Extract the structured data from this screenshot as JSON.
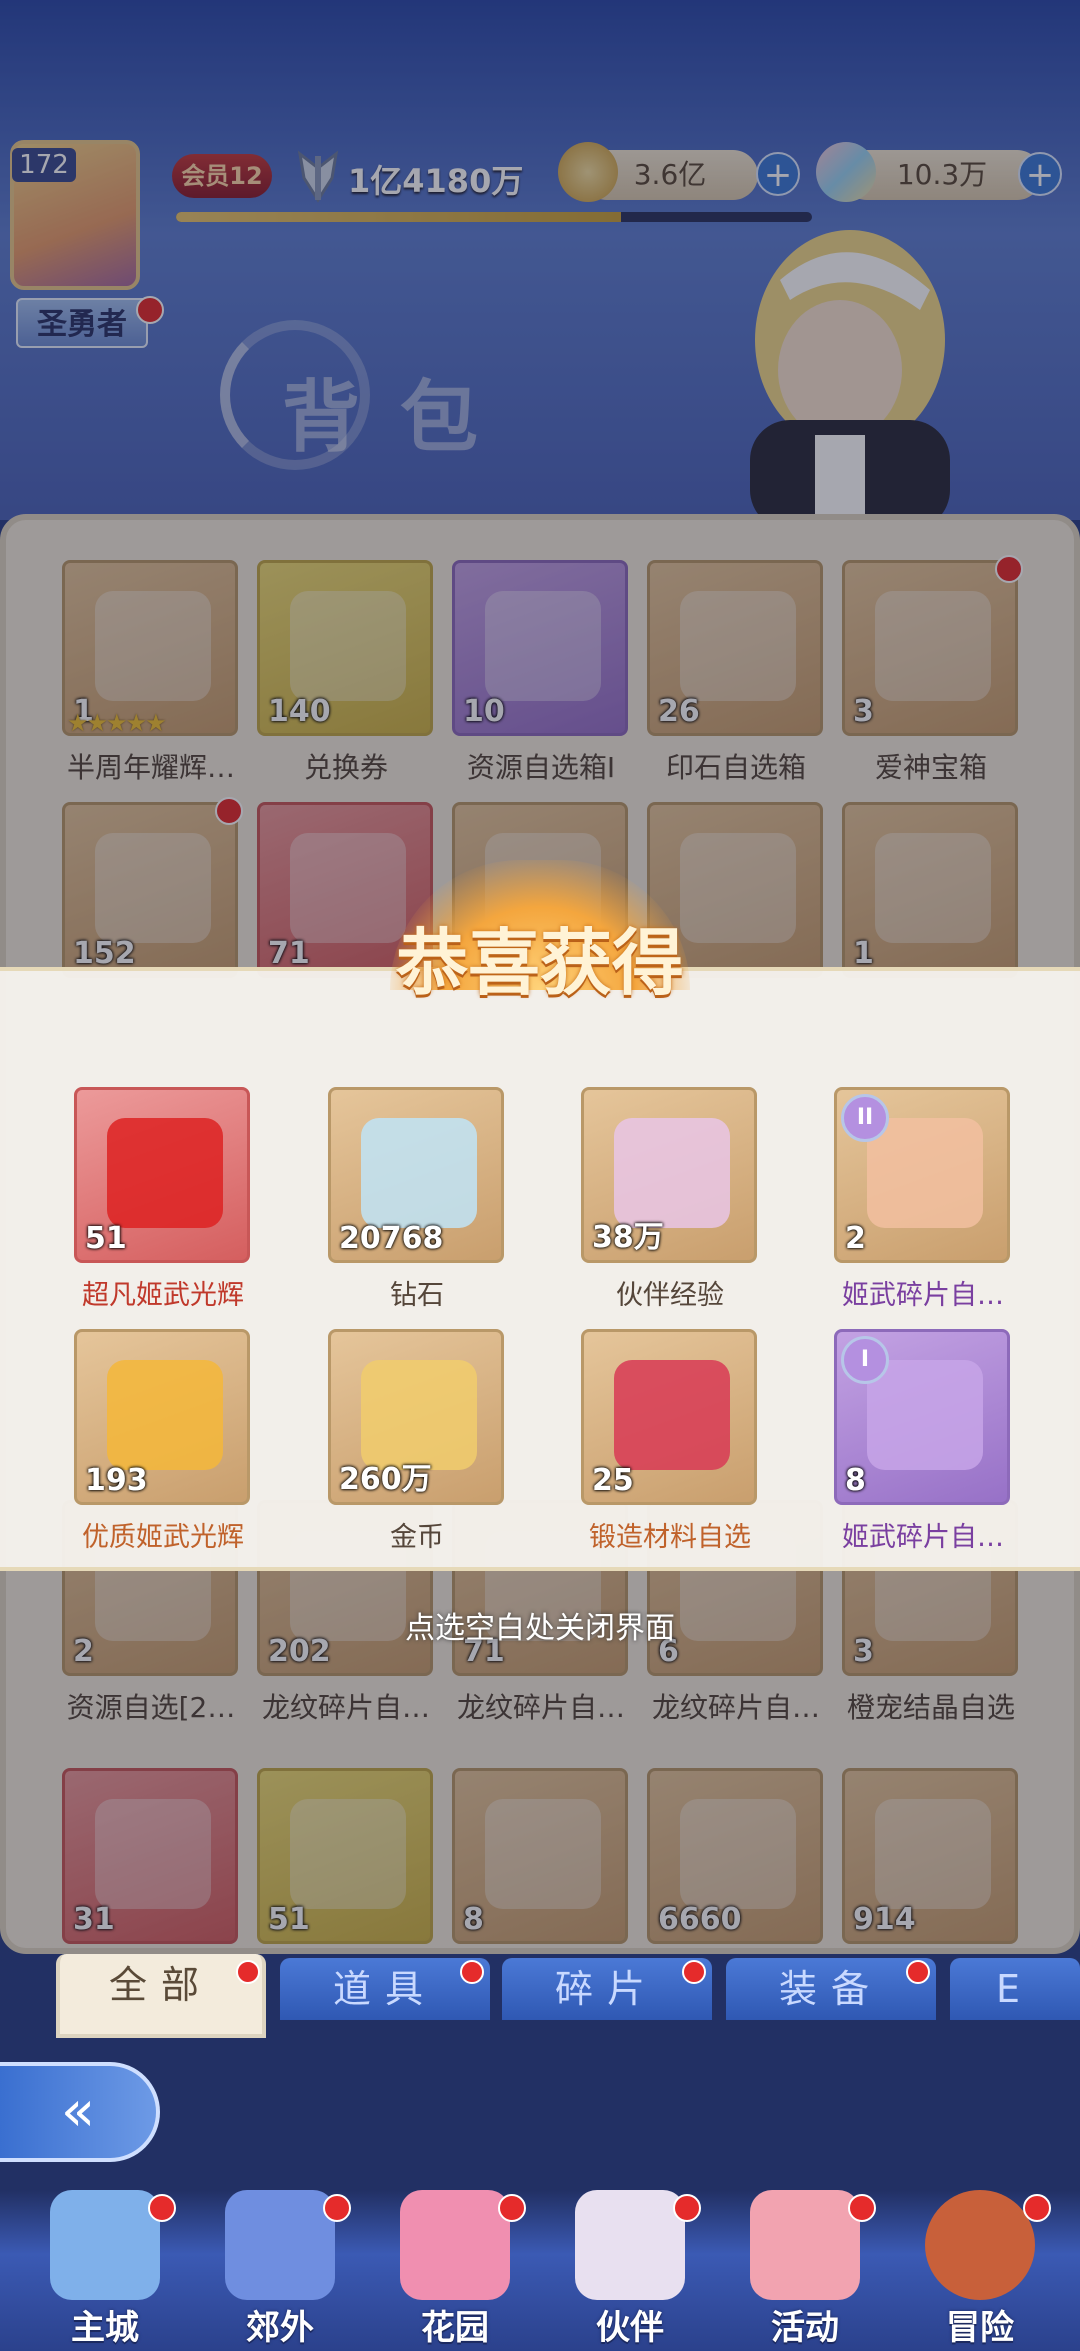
{
  "header": {
    "level": "172",
    "title": "圣勇者",
    "vip": "会员12",
    "power": "1亿4180万",
    "exp_fraction": 0.7,
    "gold": "3.6亿",
    "diamond": "10.3万",
    "page_title": "背包"
  },
  "inventory": {
    "rows": [
      [
        {
          "name": "半周年耀辉…",
          "qty": "1",
          "stars": "★★★★★",
          "style": "default",
          "dot": false
        },
        {
          "name": "兑换券",
          "qty": "140",
          "stars": "",
          "style": "yellow",
          "dot": false
        },
        {
          "name": "资源自选箱I",
          "qty": "10",
          "stars": "",
          "style": "purple",
          "dot": false
        },
        {
          "name": "印石自选箱",
          "qty": "26",
          "stars": "",
          "style": "default",
          "dot": false
        },
        {
          "name": "爱神宝箱",
          "qty": "3",
          "stars": "",
          "style": "default",
          "dot": true
        }
      ],
      [
        {
          "name": "",
          "qty": "152",
          "stars": "",
          "style": "default",
          "dot": true
        },
        {
          "name": "",
          "qty": "71",
          "stars": "",
          "style": "red",
          "dot": false
        },
        {
          "name": "",
          "qty": "",
          "stars": "",
          "style": "default",
          "dot": false
        },
        {
          "name": "",
          "qty": "",
          "stars": "",
          "style": "default",
          "dot": false
        },
        {
          "name": "",
          "qty": "1",
          "stars": "",
          "style": "default",
          "dot": false
        }
      ],
      [
        {
          "name": "资源自选[2…",
          "qty": "2",
          "stars": "",
          "style": "default",
          "dot": false
        },
        {
          "name": "龙纹碎片自…",
          "qty": "202",
          "stars": "",
          "style": "default",
          "dot": false
        },
        {
          "name": "龙纹碎片自…",
          "qty": "71",
          "stars": "",
          "style": "default",
          "dot": false
        },
        {
          "name": "龙纹碎片自…",
          "qty": "6",
          "stars": "",
          "style": "default",
          "dot": false
        },
        {
          "name": "橙宠结晶自选",
          "qty": "3",
          "stars": "",
          "style": "default",
          "dot": false
        }
      ],
      [
        {
          "name": "",
          "qty": "31",
          "stars": "",
          "style": "red",
          "dot": false
        },
        {
          "name": "",
          "qty": "51",
          "stars": "",
          "style": "yellow",
          "dot": false
        },
        {
          "name": "",
          "qty": "8",
          "stars": "",
          "style": "default",
          "dot": false
        },
        {
          "name": "",
          "qty": "6660",
          "stars": "",
          "style": "default",
          "dot": false
        },
        {
          "name": "",
          "qty": "914",
          "stars": "",
          "style": "default",
          "dot": false
        }
      ]
    ]
  },
  "reward_modal": {
    "title": "恭喜获得",
    "items": [
      {
        "name": "超凡姬武光辉",
        "qty": "51",
        "style": "red",
        "name_color": "#c0392b",
        "tier": ""
      },
      {
        "name": "钻石",
        "qty": "20768",
        "style": "default",
        "name_color": "#55463a",
        "tier": ""
      },
      {
        "name": "伙伴经验",
        "qty": "38万",
        "style": "default",
        "name_color": "#55463a",
        "tier": ""
      },
      {
        "name": "姬武碎片自…",
        "qty": "2",
        "style": "default",
        "name_color": "#7a3fa0",
        "tier": "II"
      },
      {
        "name": "优质姬武光辉",
        "qty": "193",
        "style": "default",
        "name_color": "#c0622b",
        "tier": ""
      },
      {
        "name": "金币",
        "qty": "260万",
        "style": "default",
        "name_color": "#55463a",
        "tier": ""
      },
      {
        "name": "锻造材料自选",
        "qty": "25",
        "style": "default",
        "name_color": "#c0622b",
        "tier": ""
      },
      {
        "name": "姬武碎片自…",
        "qty": "8",
        "style": "purple",
        "name_color": "#7a3fa0",
        "tier": "I"
      }
    ],
    "hint": "点选空白处关闭界面"
  },
  "tabs": [
    "全部",
    "道具",
    "碎片",
    "装备",
    "E"
  ],
  "bottom_nav": [
    "主城",
    "郊外",
    "花园",
    "伙伴",
    "活动",
    "冒险"
  ]
}
